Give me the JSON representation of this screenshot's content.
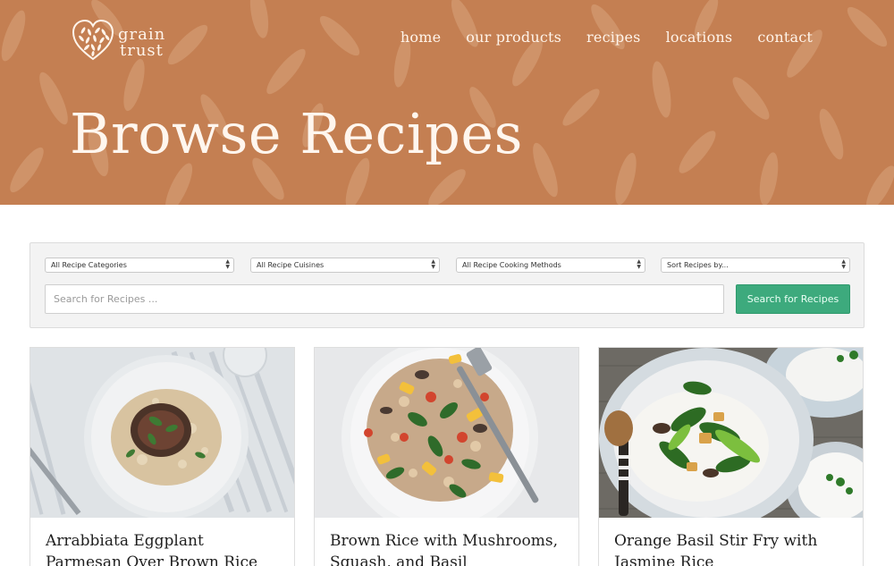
{
  "brand": {
    "logo_line1": "grain",
    "logo_line2": "trust",
    "logo_icon": "heart-grain-logo-icon"
  },
  "nav": {
    "items": [
      {
        "label": "home"
      },
      {
        "label": "our products"
      },
      {
        "label": "recipes"
      },
      {
        "label": "locations"
      },
      {
        "label": "contact"
      }
    ]
  },
  "hero": {
    "title": "Browse Recipes",
    "background_color": "#c47f52"
  },
  "filters": {
    "selects": [
      {
        "selected": "All Recipe Categories"
      },
      {
        "selected": "All Recipe Cuisines"
      },
      {
        "selected": "All Recipe Cooking Methods"
      },
      {
        "selected": "Sort Recipes by..."
      }
    ],
    "search_placeholder": "Search for Recipes ...",
    "search_button_label": "Search for Recipes",
    "accent_color": "#3daa7d"
  },
  "recipes": [
    {
      "title": "Arrabbiata Eggplant Parmesan Over Brown Rice"
    },
    {
      "title": "Brown Rice with Mushrooms, Squash, and Basil"
    },
    {
      "title": "Orange Basil Stir Fry with Jasmine Rice"
    }
  ]
}
